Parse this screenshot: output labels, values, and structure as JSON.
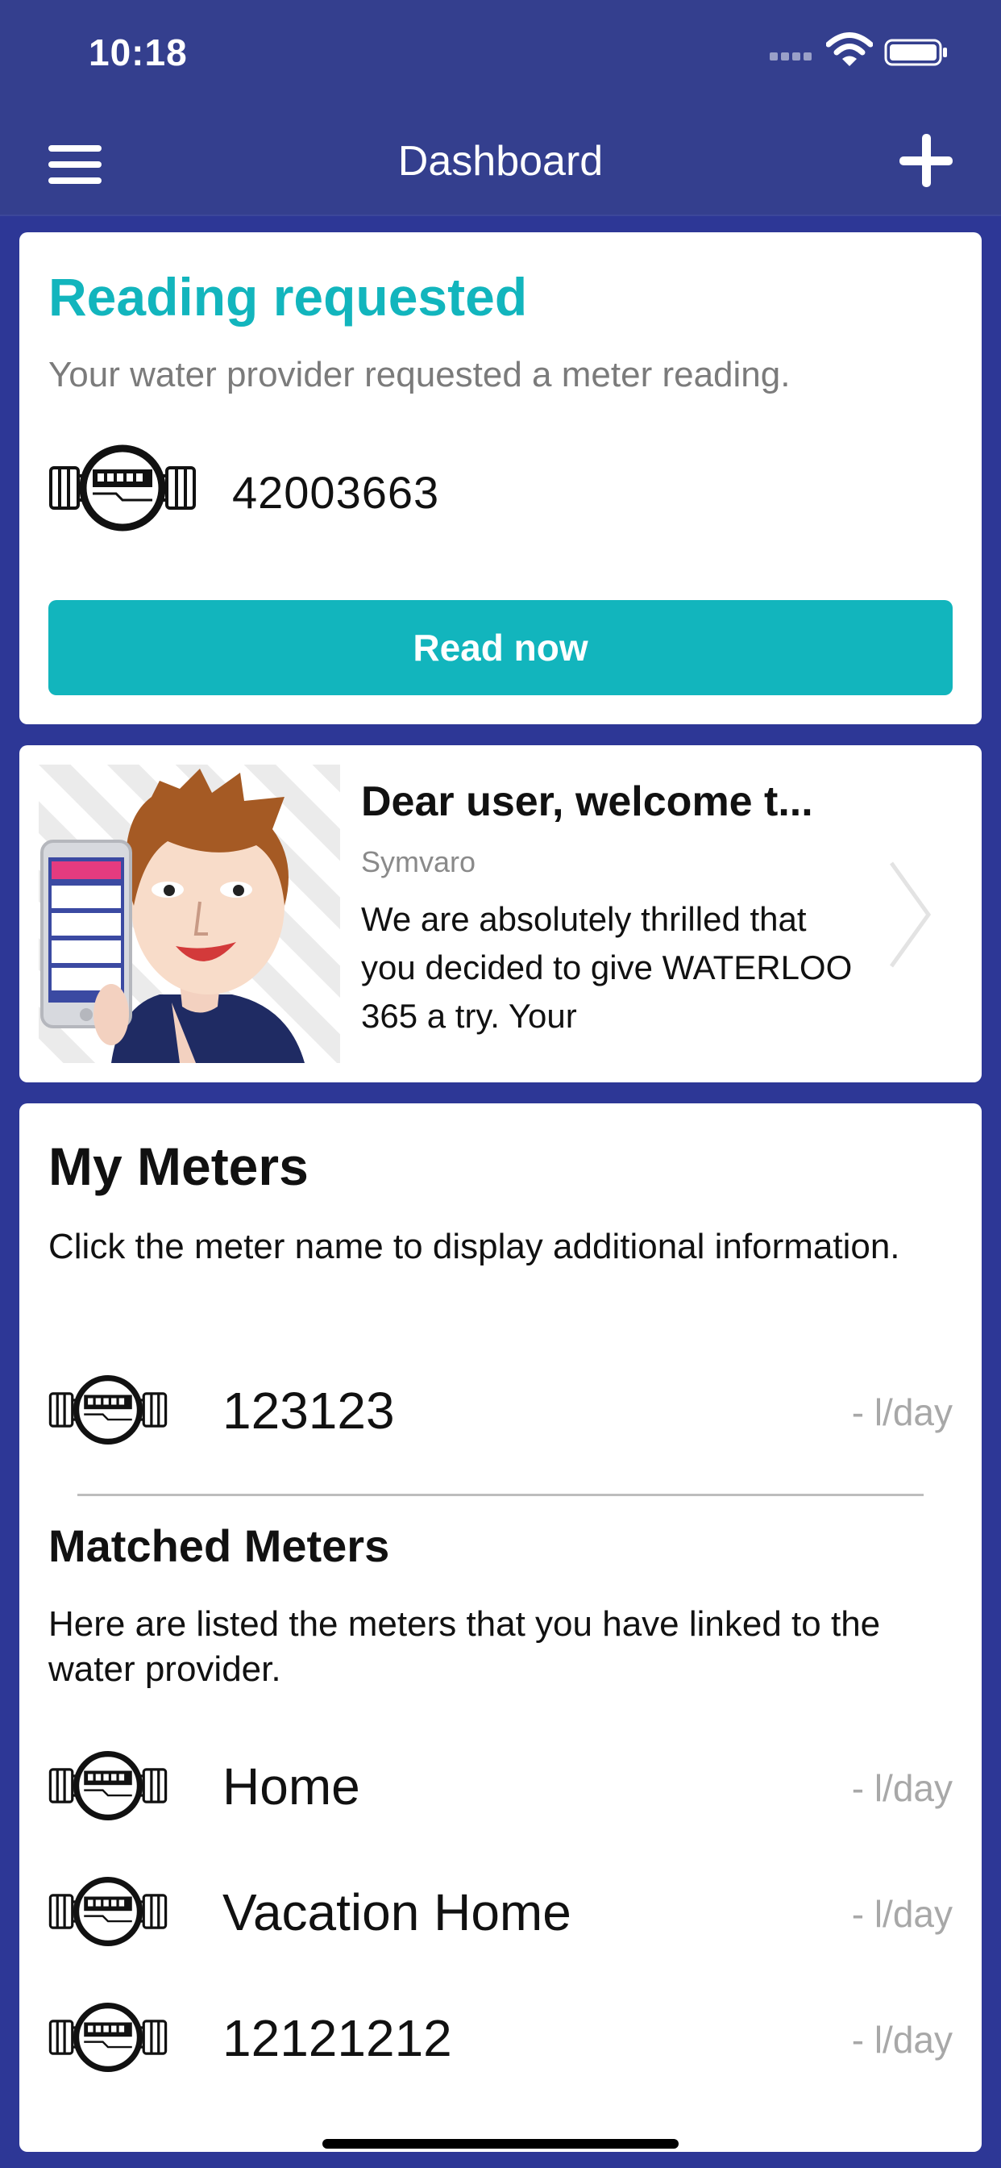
{
  "status_bar": {
    "time": "10:18"
  },
  "nav": {
    "title": "Dashboard"
  },
  "reading_card": {
    "title": "Reading requested",
    "subtitle": "Your water provider requested a meter reading.",
    "meter_id": "42003663",
    "button_label": "Read now"
  },
  "news_card": {
    "title": "Dear user, welcome t...",
    "source": "Symvaro",
    "body": "We are absolutely thrilled that you decided to give WATERLOO 365 a try. Your"
  },
  "my_meters": {
    "title": "My Meters",
    "description": "Click the meter name to display additional information.",
    "items": [
      {
        "name": "123123",
        "usage": "- l/day"
      }
    ]
  },
  "matched_meters": {
    "title": "Matched Meters",
    "description": "Here are listed the meters that you have linked to the water provider.",
    "items": [
      {
        "name": "Home",
        "usage": "- l/day"
      },
      {
        "name": "Vacation Home",
        "usage": "- l/day"
      },
      {
        "name": "12121212",
        "usage": "- l/day"
      }
    ]
  },
  "colors": {
    "brand_blue": "#2d3796",
    "header_blue": "#343f8e",
    "accent_teal": "#12b5bd",
    "muted_text": "#a8a8a8"
  },
  "icons": [
    "menu-icon",
    "add-icon",
    "water-meter-icon",
    "chevron-right-icon",
    "wifi-icon",
    "battery-icon"
  ]
}
